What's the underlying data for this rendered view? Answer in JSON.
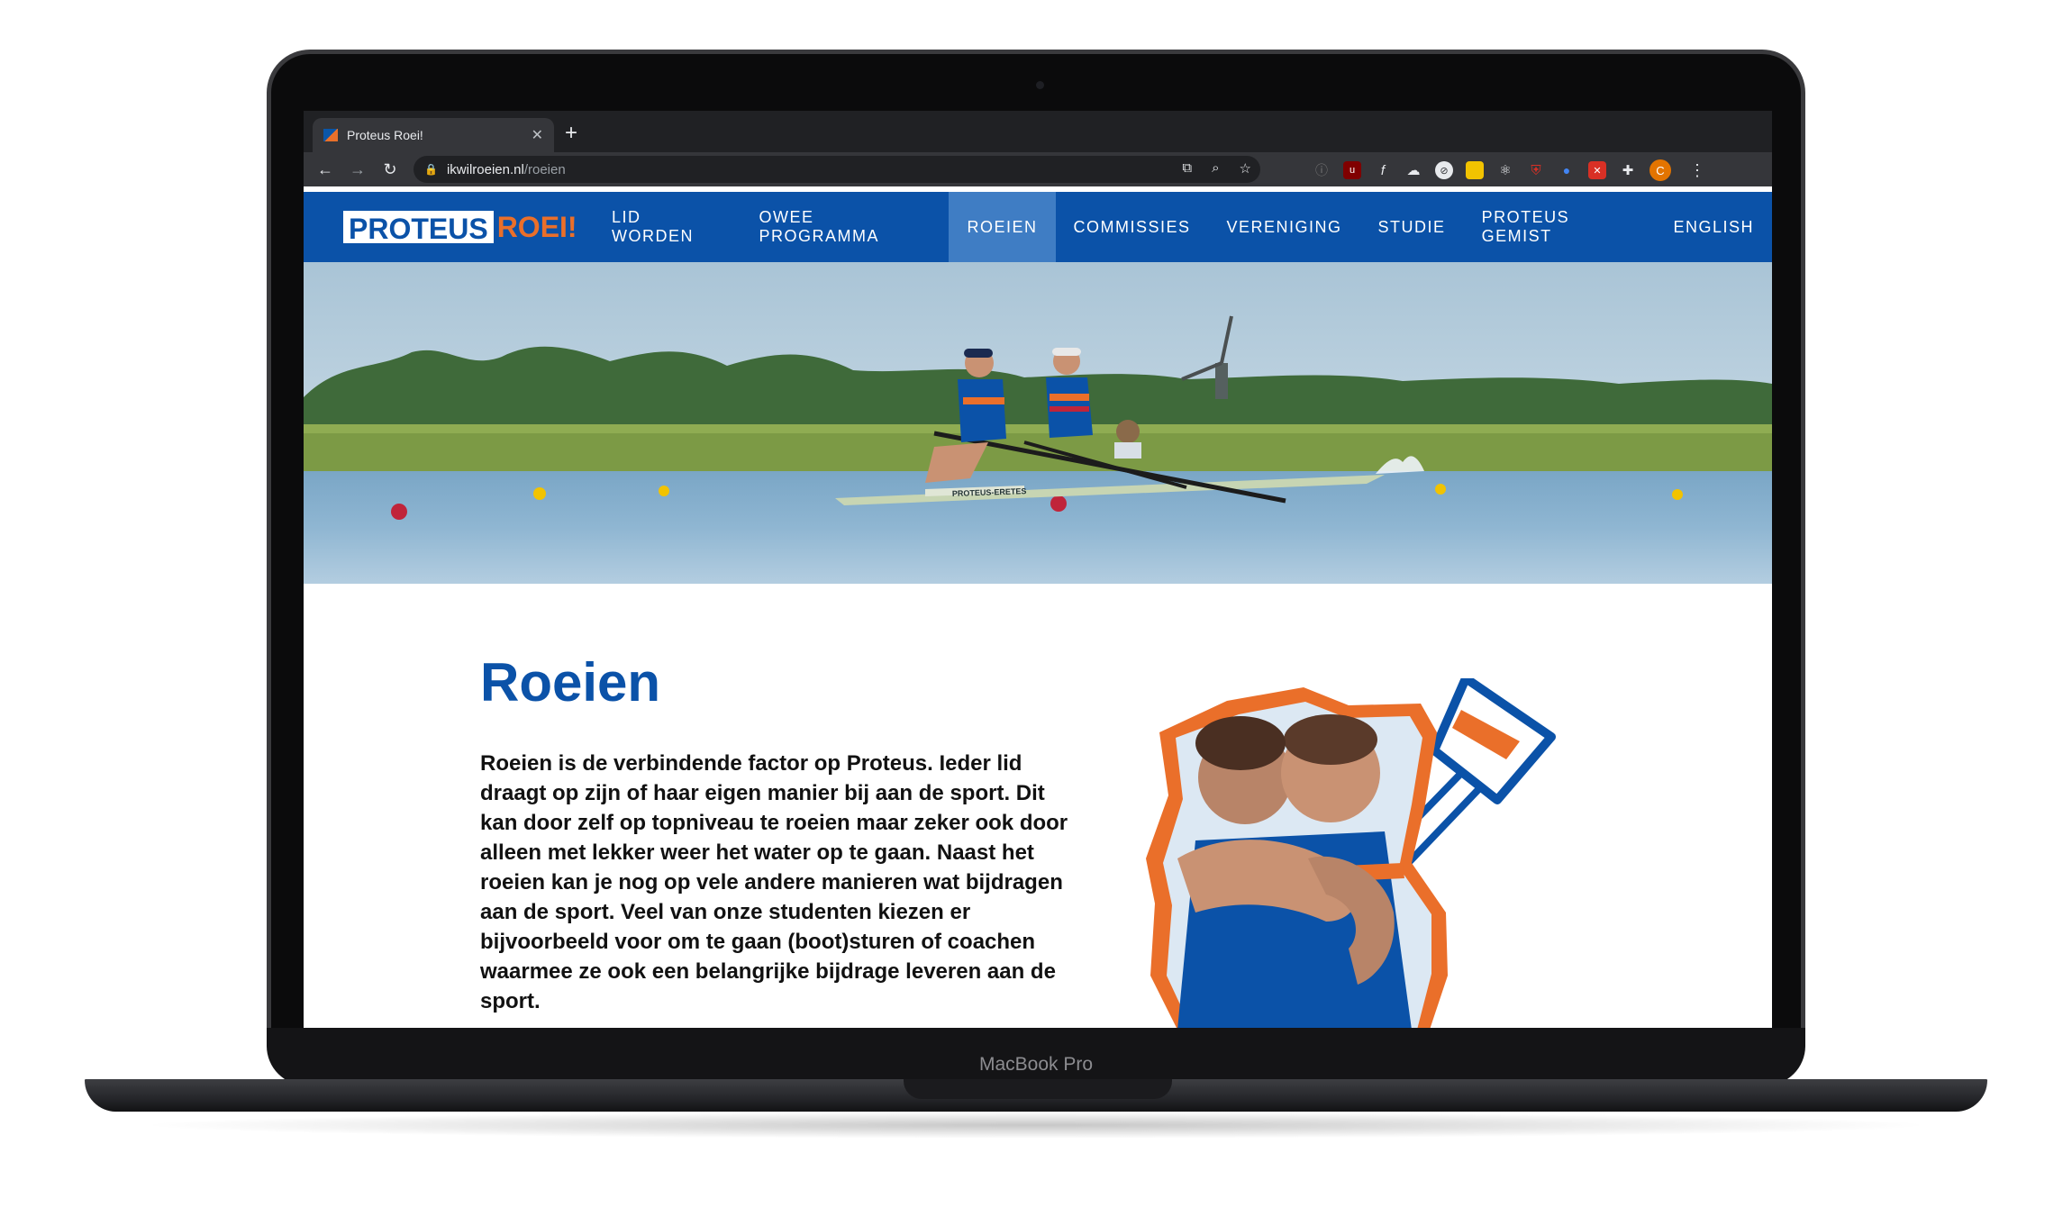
{
  "device": {
    "brand_label": "MacBook Pro"
  },
  "browser": {
    "tab_title": "Proteus Roei!",
    "tab_close": "✕",
    "new_tab": "+",
    "url_host": "ikwilroeien.nl",
    "url_path": "/roeien",
    "profile_initial": "C"
  },
  "site": {
    "logo_part1": "PROTEUS",
    "logo_part2": "ROEI!",
    "nav": [
      {
        "label": "LID WORDEN"
      },
      {
        "label": "OWEE PROGRAMMA"
      },
      {
        "label": "ROEIEN",
        "active": true
      },
      {
        "label": "COMMISSIES"
      },
      {
        "label": "VERENIGING"
      },
      {
        "label": "STUDIE"
      },
      {
        "label": "PROTEUS GEMIST"
      },
      {
        "label": "ENGLISH"
      }
    ],
    "boat_text": "PROTEUS-ERETES",
    "page_title": "Roeien",
    "intro": "Roeien is de verbindende factor op Proteus. Ieder lid draagt op zijn of haar eigen manier bij aan de sport. Dit kan door zelf op topniveau te roeien maar zeker ook door alleen met lekker weer het water op te gaan. Naast het roeien kan je nog op vele andere manieren wat bijdragen aan de sport. Veel van onze studenten kiezen er bijvoorbeeld voor om te gaan (boot)sturen of coachen waarmee ze ook een belangrijke bijdrage leveren aan de sport."
  },
  "colors": {
    "brand_blue": "#0b52a8",
    "brand_orange": "#ea6f2a",
    "nav_active": "#3f7dc4"
  }
}
